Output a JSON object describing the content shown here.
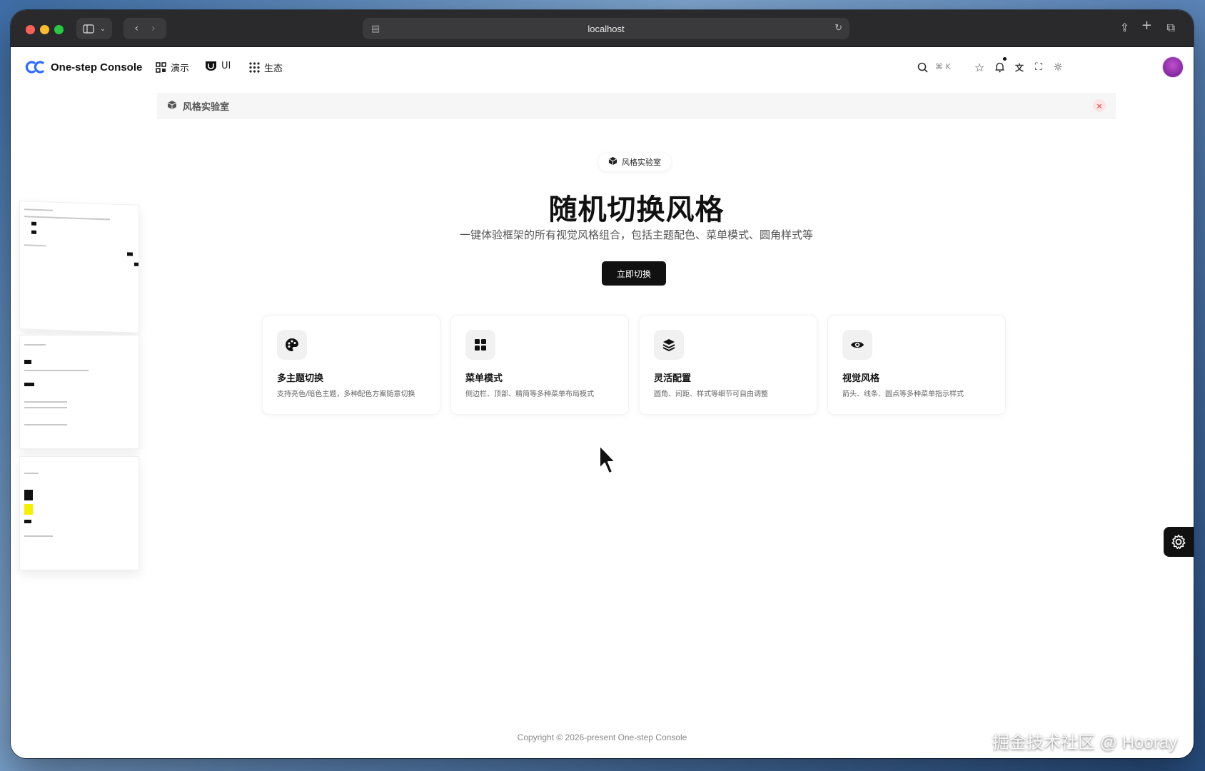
{
  "browser": {
    "address": "localhost"
  },
  "header": {
    "brand": "One-step Console",
    "nav": [
      {
        "label": "演示",
        "icon": "dashboard-icon"
      },
      {
        "label": "UI",
        "icon": "shield-icon"
      },
      {
        "label": "生态",
        "icon": "grid-icon"
      }
    ],
    "search_kbd": "⌘ K"
  },
  "tabs": [
    {
      "label": "风格实验室",
      "icon": "cube-icon"
    }
  ],
  "hero": {
    "badge": "风格实验室",
    "title": "随机切换风格",
    "subtitle": "一键体验框架的所有视觉风格组合，包括主题配色、菜单模式、圆角样式等",
    "cta": "立即切换"
  },
  "features": [
    {
      "icon": "palette-icon",
      "title": "多主题切换",
      "desc": "支持亮色/暗色主题，多种配色方案随意切换"
    },
    {
      "icon": "grid-icon",
      "title": "菜单模式",
      "desc": "侧边栏、顶部、精简等多种菜单布局模式"
    },
    {
      "icon": "layers-icon",
      "title": "灵活配置",
      "desc": "圆角、间距、样式等细节可自由调整"
    },
    {
      "icon": "eye-icon",
      "title": "视觉风格",
      "desc": "箭头、线条、圆点等多种菜单指示样式"
    }
  ],
  "footer": "Copyright © 2026-present  One-step Console",
  "watermark": "掘金技术社区 @ Hooray",
  "colors": {
    "primary": "#111111",
    "accent_red": "#d33333",
    "background": "#ffffff"
  }
}
